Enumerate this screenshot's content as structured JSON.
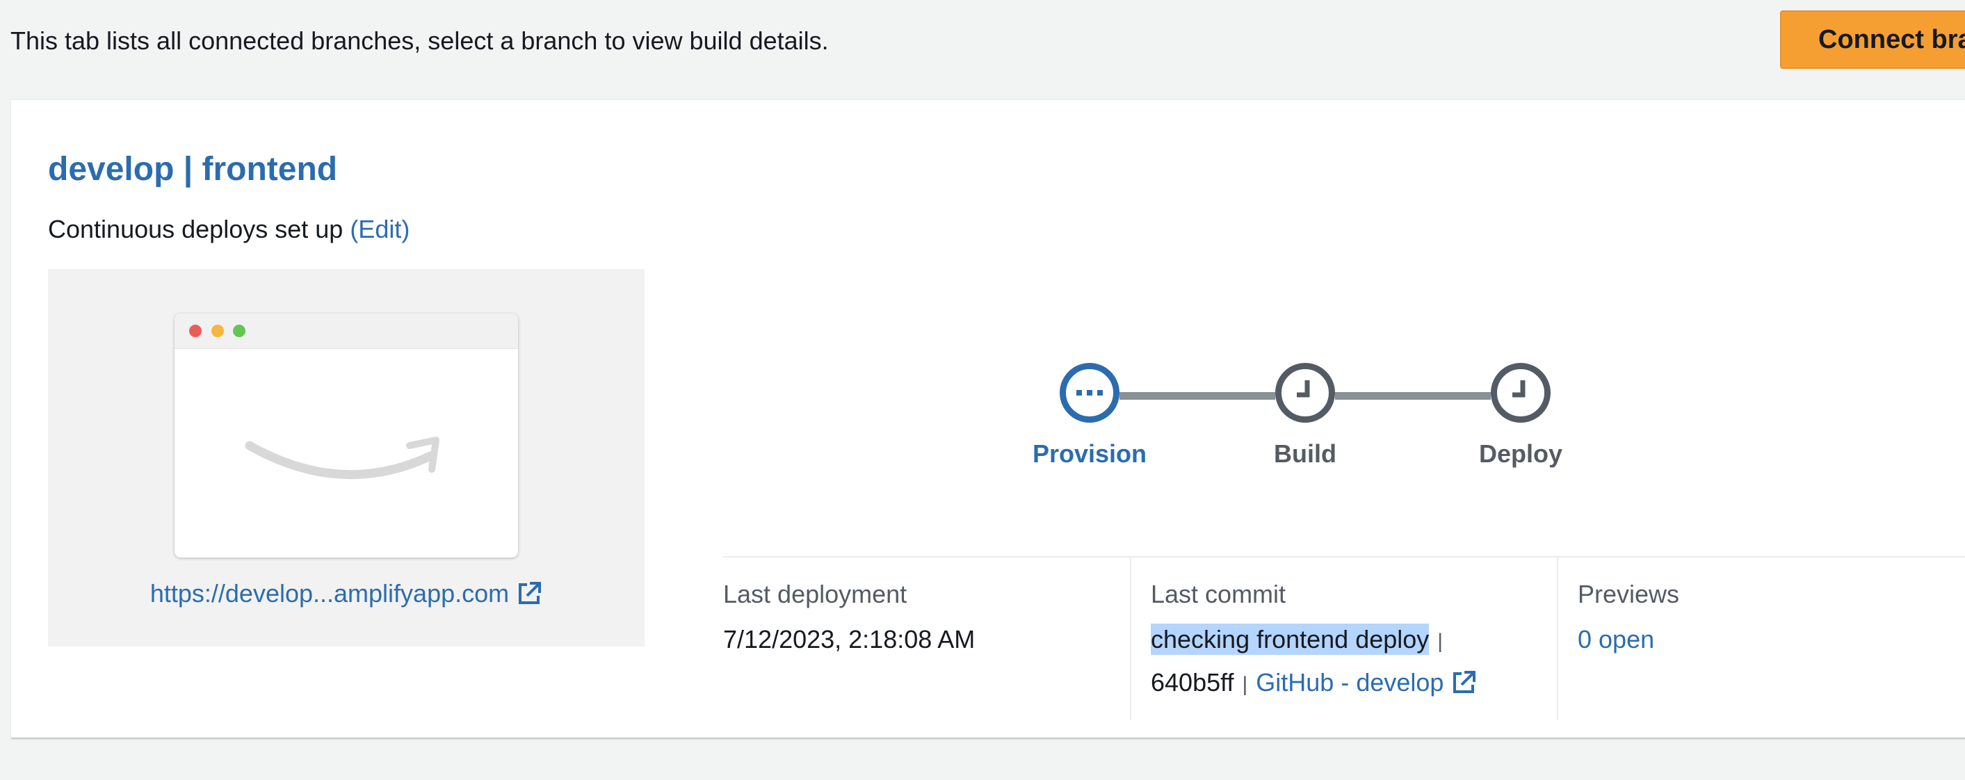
{
  "header": {
    "description": "This tab lists all connected branches, select a branch to view build details.",
    "connect_button": "Connect branch"
  },
  "branch": {
    "title": "develop | frontend",
    "cd_text": "Continuous deploys set up",
    "edit_label": "(Edit)",
    "preview_url": "https://develop...amplifyapp.com"
  },
  "pipeline": {
    "steps": [
      {
        "label": "Provision",
        "status": "in-progress",
        "icon": "ellipsis-icon"
      },
      {
        "label": "Build",
        "status": "pending",
        "icon": "clock-icon"
      },
      {
        "label": "Deploy",
        "status": "pending",
        "icon": "clock-icon"
      }
    ]
  },
  "details": {
    "last_deployment": {
      "label": "Last deployment",
      "value": "7/12/2023, 2:18:08 AM"
    },
    "last_commit": {
      "label": "Last commit",
      "message": "checking frontend deploy",
      "hash": "640b5ff",
      "provider": "GitHub",
      "dash": "-",
      "branch": "develop"
    },
    "previews": {
      "label": "Previews",
      "value": "0 open"
    }
  },
  "colors": {
    "link": "#2b6cb0",
    "primary_button": "#f59f33",
    "pending": "#545b64",
    "highlight": "#b4d5fe"
  }
}
